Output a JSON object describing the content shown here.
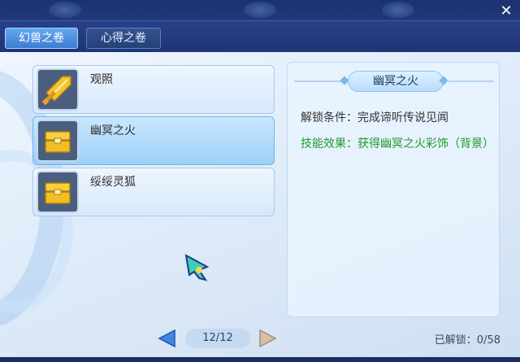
{
  "window": {
    "close_symbol": "✕"
  },
  "tabs": [
    {
      "label": "幻兽之卷",
      "active": true
    },
    {
      "label": "心得之卷",
      "active": false
    }
  ],
  "list": [
    {
      "label": "观照",
      "icon": "sword-icon",
      "selected": false
    },
    {
      "label": "幽冥之火",
      "icon": "chest-icon",
      "selected": true
    },
    {
      "label": "绥绥灵狐",
      "icon": "chest-icon",
      "selected": false
    }
  ],
  "detail": {
    "title": "幽冥之火",
    "unlock_condition": "解锁条件：完成谛听传说见闻",
    "effect": "技能效果：获得幽冥之火彩饰（背景）"
  },
  "pager": {
    "page": "12/12"
  },
  "unlocked": "已解锁：0/58",
  "colors": {
    "accent": "#3c7bd3",
    "effect_text": "#1f9a2a",
    "frame": "#1a2d63"
  }
}
